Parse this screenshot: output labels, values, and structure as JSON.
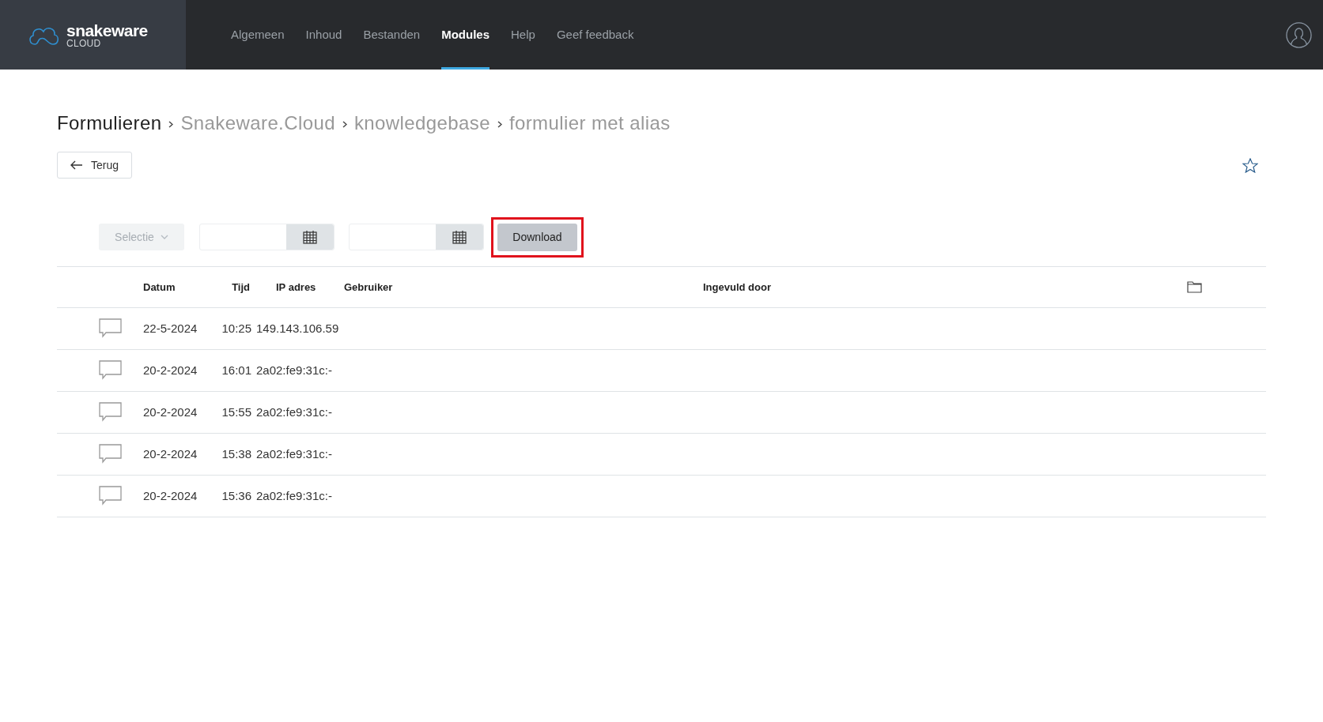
{
  "header": {
    "logo": {
      "name": "snakeware",
      "sub": "CLOUD"
    },
    "nav": [
      {
        "label": "Algemeen",
        "selected": false
      },
      {
        "label": "Inhoud",
        "selected": false
      },
      {
        "label": "Bestanden",
        "selected": false
      },
      {
        "label": "Modules",
        "selected": true
      },
      {
        "label": "Help",
        "selected": false
      },
      {
        "label": "Geef feedback",
        "selected": false
      }
    ]
  },
  "breadcrumb": [
    "Formulieren",
    "Snakeware.Cloud",
    "knowledgebase",
    "formulier met alias"
  ],
  "back_button": {
    "label": "Terug"
  },
  "filters": {
    "selection": {
      "label": "Selectie",
      "disabled": true
    },
    "download": {
      "label": "Download",
      "highlighted": true
    }
  },
  "table": {
    "columns": [
      "Datum",
      "Tijd",
      "IP adres",
      "Gebruiker",
      "Ingevuld door"
    ],
    "rows": [
      {
        "datum": "22-5-2024",
        "tijd": "10:25",
        "ip": "149.143.106.59"
      },
      {
        "datum": "20-2-2024",
        "tijd": "16:01",
        "ip": "2a02:fe9:31c:-"
      },
      {
        "datum": "20-2-2024",
        "tijd": "15:55",
        "ip": "2a02:fe9:31c:-"
      },
      {
        "datum": "20-2-2024",
        "tijd": "15:38",
        "ip": "2a02:fe9:31c:-"
      },
      {
        "datum": "20-2-2024",
        "tijd": "15:36",
        "ip": "2a02:fe9:31c:-"
      }
    ]
  }
}
